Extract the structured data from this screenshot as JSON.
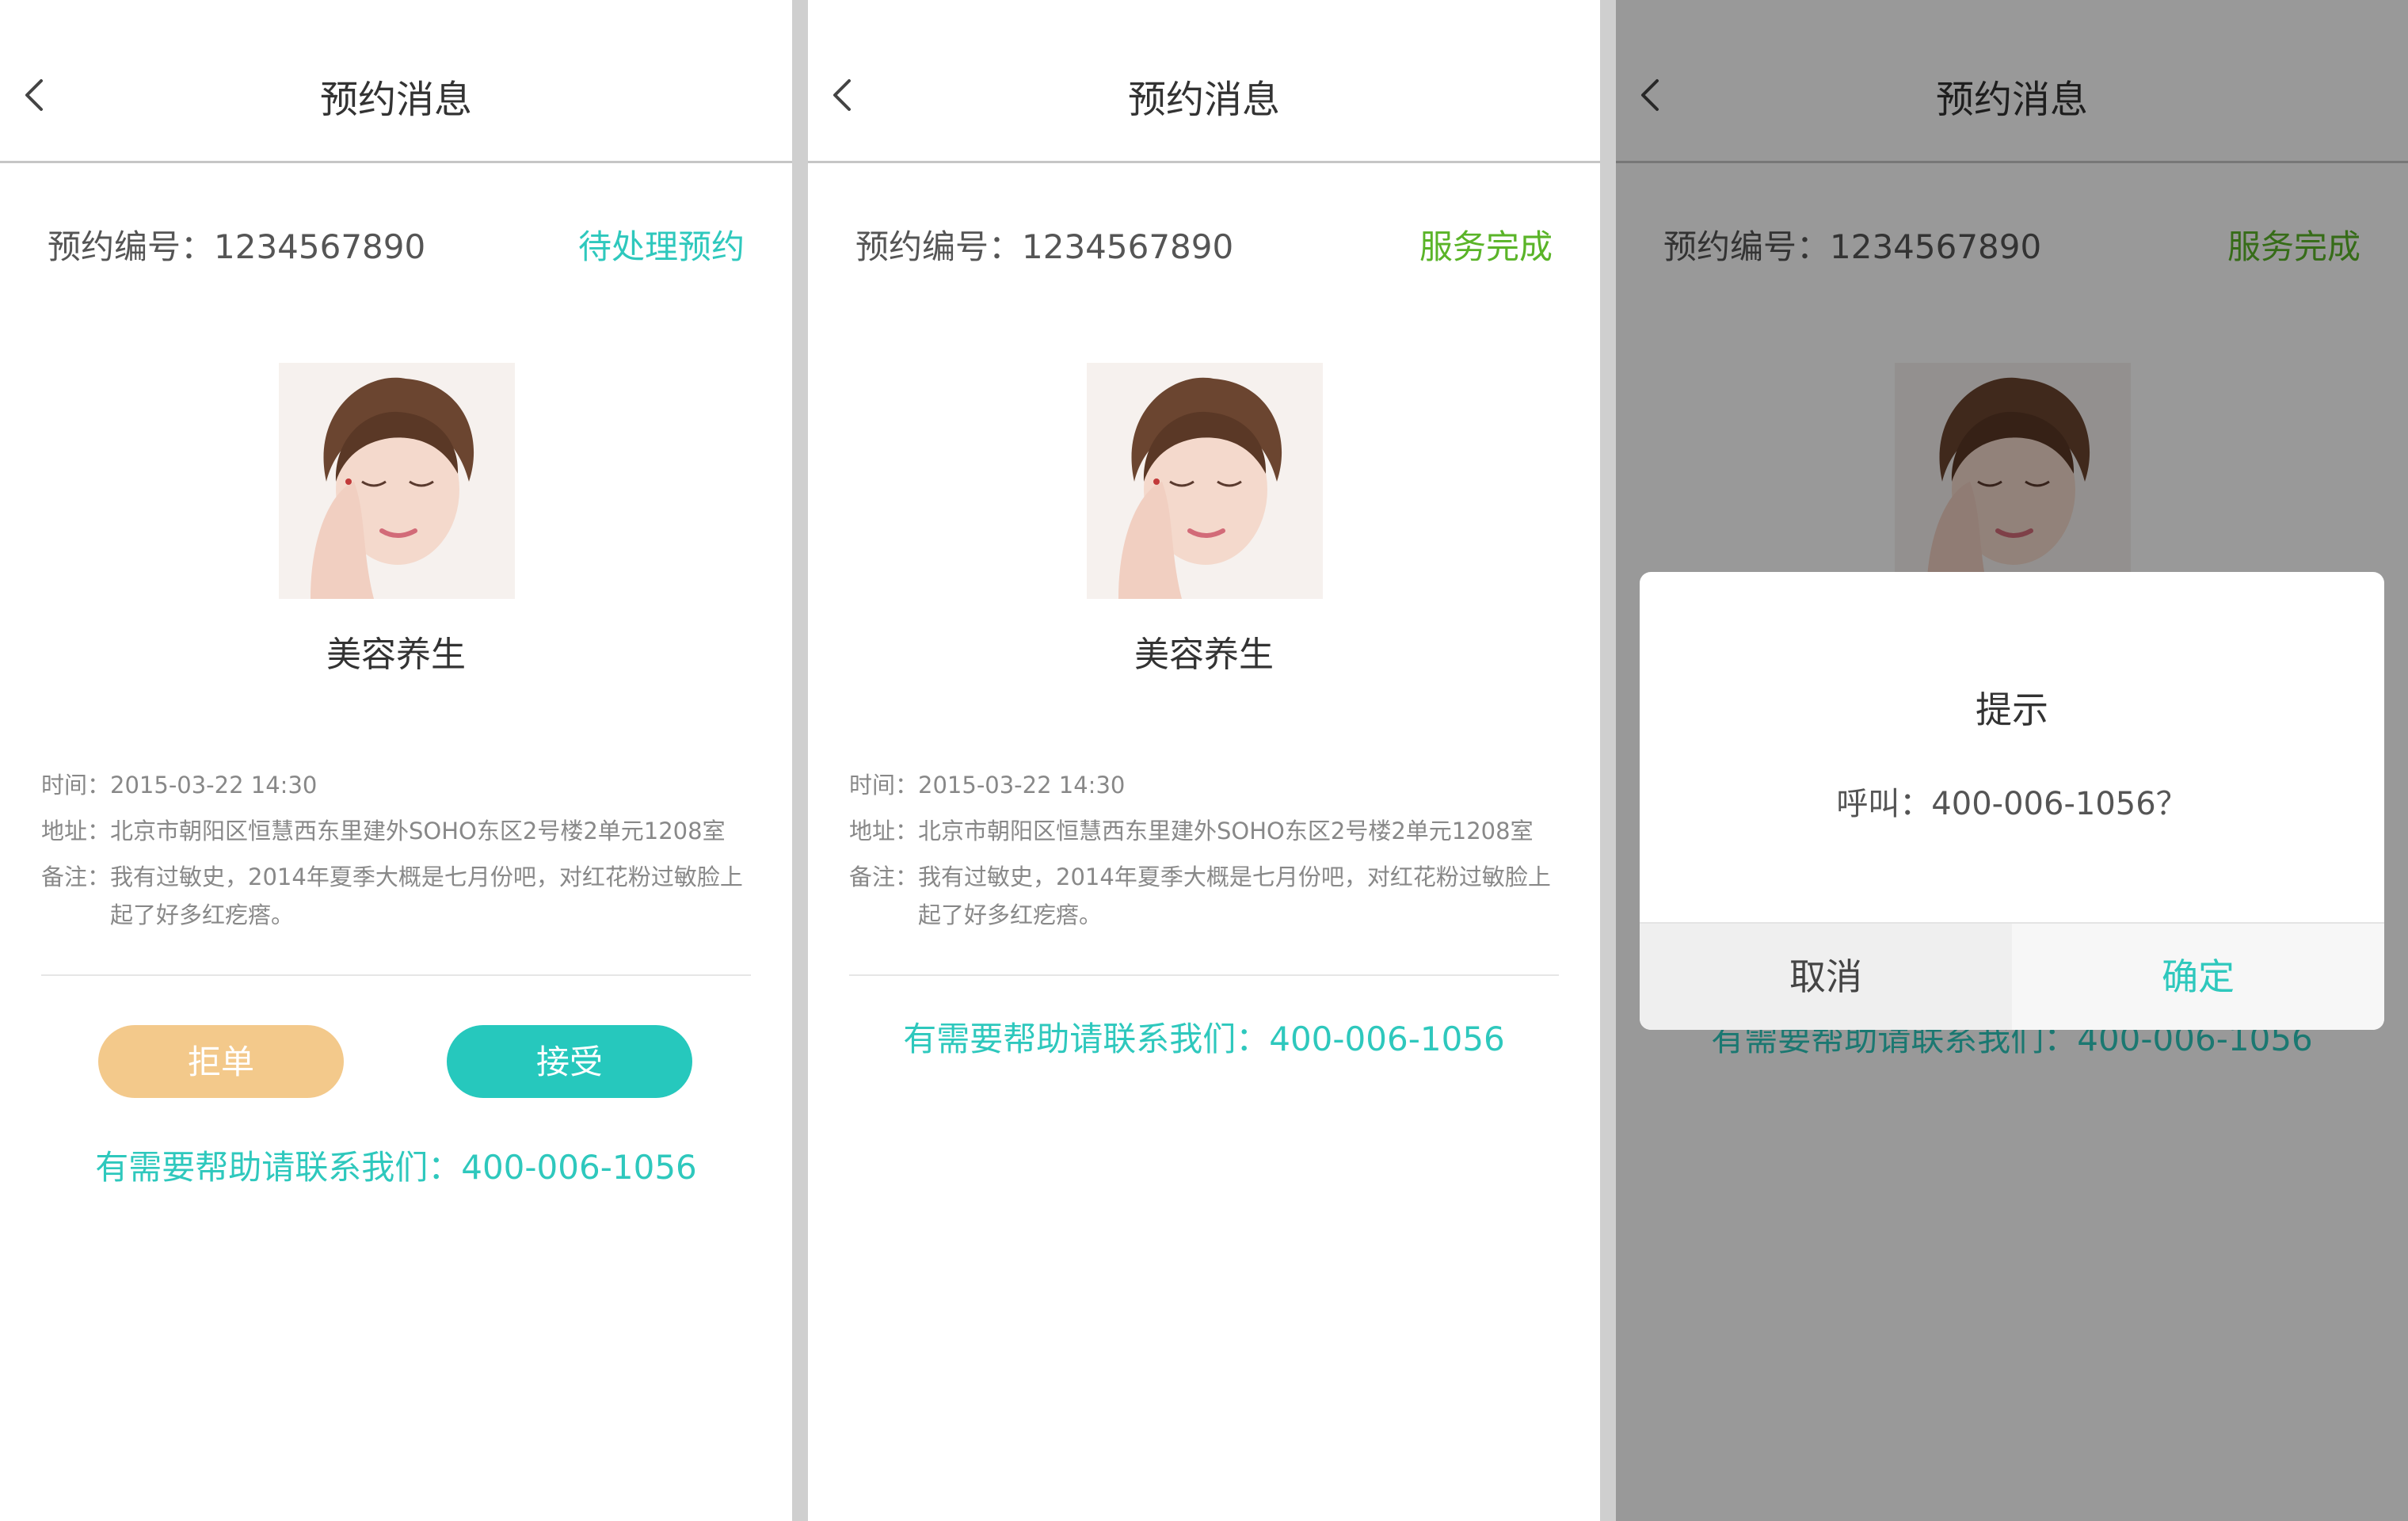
{
  "colors": {
    "accent_teal": "#2ec8bd",
    "status_done_green": "#5ab428",
    "reject_button": "#f3c98b",
    "accept_button": "#26c8bd"
  },
  "screens": [
    {
      "nav": {
        "back_icon": "chevron-left-icon",
        "title": "预约消息"
      },
      "order": {
        "label": "预约编号：1234567890",
        "status": "待处理预约"
      },
      "service": {
        "image": "woman-portrait",
        "name": "美容养生"
      },
      "details": {
        "time_label": "时间：",
        "time": "2015-03-22  14:30",
        "address_label": "地址：",
        "address": "北京市朝阳区恒慧西东里建外SOHO东区2号楼2单元1208室",
        "note_label": "备注：",
        "note": "我有过敏史，2014年夏季大概是七月份吧，对红花粉过敏脸上起了好多红疙瘩。"
      },
      "actions": {
        "reject": "拒单",
        "accept": "接受"
      },
      "help": "有需要帮助请联系我们：400-006-1056"
    },
    {
      "nav": {
        "back_icon": "chevron-left-icon",
        "title": "预约消息"
      },
      "order": {
        "label": "预约编号：1234567890",
        "status": "服务完成"
      },
      "service": {
        "image": "woman-portrait",
        "name": "美容养生"
      },
      "details": {
        "time_label": "时间：",
        "time": "2015-03-22  14:30",
        "address_label": "地址：",
        "address": "北京市朝阳区恒慧西东里建外SOHO东区2号楼2单元1208室",
        "note_label": "备注：",
        "note": "我有过敏史，2014年夏季大概是七月份吧，对红花粉过敏脸上起了好多红疙瘩。"
      },
      "help": "有需要帮助请联系我们：400-006-1056"
    },
    {
      "nav": {
        "back_icon": "chevron-left-icon",
        "title": "预约消息"
      },
      "order": {
        "label": "预约编号：1234567890",
        "status": "服务完成"
      },
      "service": {
        "image": "woman-portrait"
      },
      "help": "有需要帮助请联系我们：400-006-1056",
      "dialog": {
        "title": "提示",
        "message": "呼叫：400-006-1056？",
        "cancel": "取消",
        "confirm": "确定"
      }
    }
  ]
}
